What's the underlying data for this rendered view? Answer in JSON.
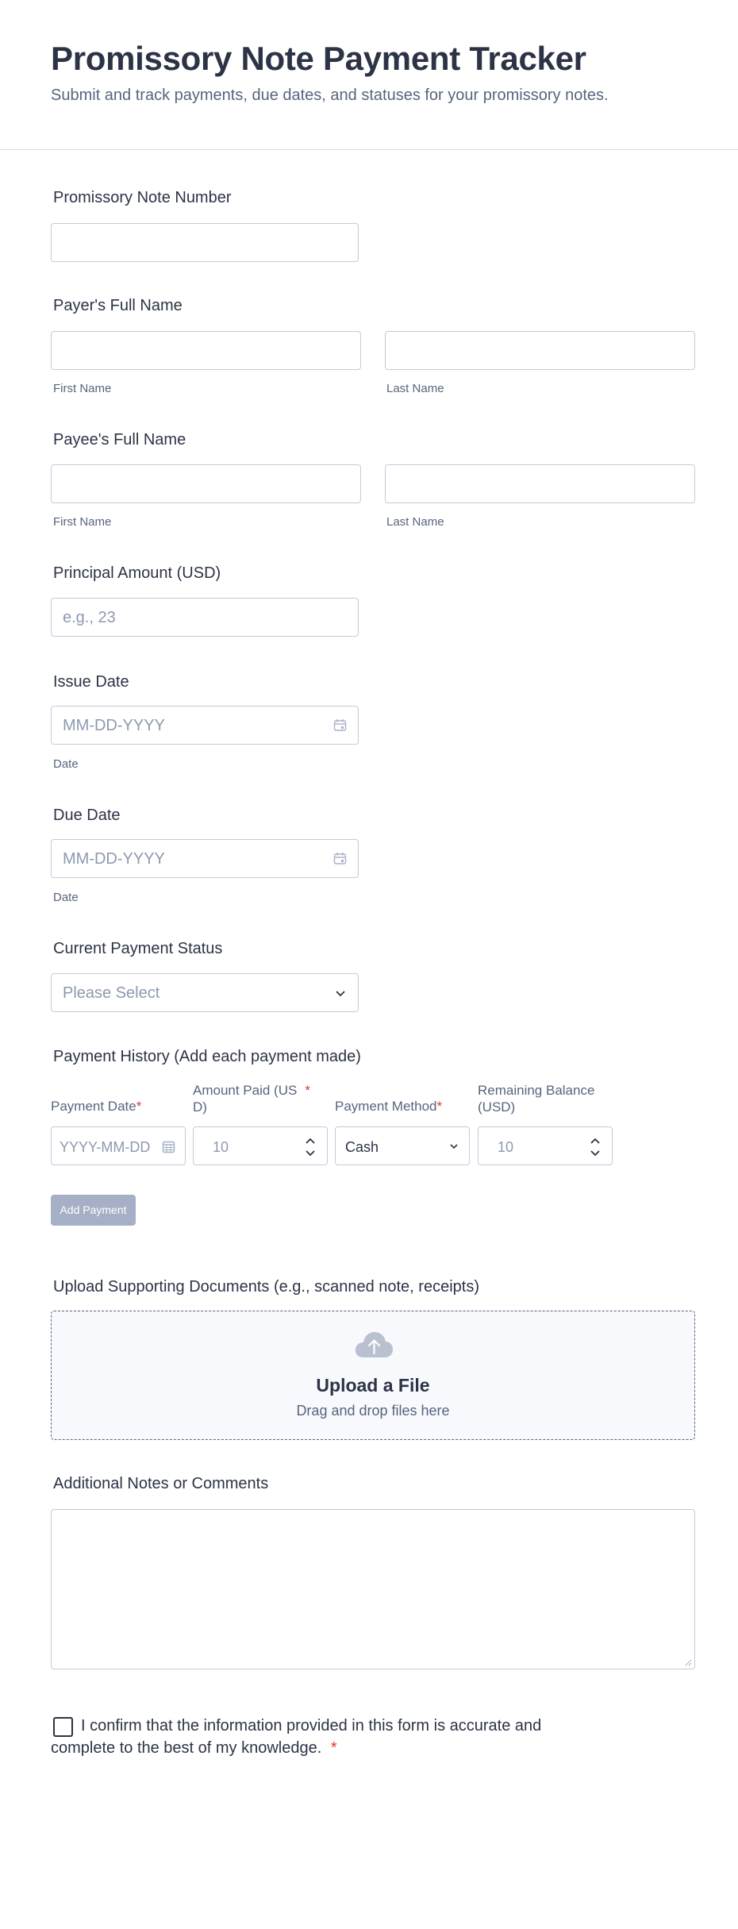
{
  "header": {
    "title": "Promissory Note Payment Tracker",
    "subtitle": "Submit and track payments, due dates, and statuses for your promissory notes."
  },
  "note_number": {
    "label": "Promissory Note Number"
  },
  "payer": {
    "label": "Payer's Full Name",
    "first_sub": "First Name",
    "last_sub": "Last Name"
  },
  "payee": {
    "label": "Payee's Full Name",
    "first_sub": "First Name",
    "last_sub": "Last Name"
  },
  "principal": {
    "label": "Principal Amount (USD)",
    "placeholder": "e.g., 23"
  },
  "issue_date": {
    "label": "Issue Date",
    "placeholder": "MM-DD-YYYY",
    "sub": "Date"
  },
  "due_date": {
    "label": "Due Date",
    "placeholder": "MM-DD-YYYY",
    "sub": "Date"
  },
  "status": {
    "label": "Current Payment Status",
    "placeholder": "Please Select"
  },
  "history": {
    "label": "Payment History (Add each payment made)",
    "columns": {
      "payment_date": "Payment Date",
      "amount_paid_line1": "Amount Paid (US",
      "amount_paid_line2": "D)",
      "payment_method": "Payment Method",
      "remaining_line1": "Remaining Balance",
      "remaining_line2": "(USD)"
    },
    "required_mark": "*",
    "row": {
      "date_placeholder": "YYYY-MM-DD",
      "amount_placeholder": "10",
      "method_value": "Cash",
      "remaining_placeholder": "10"
    },
    "add_button": "Add Payment"
  },
  "upload": {
    "label": "Upload Supporting Documents (e.g., scanned note, receipts)",
    "title": "Upload a File",
    "sub": "Drag and drop files here"
  },
  "notes": {
    "label": "Additional Notes or Comments"
  },
  "confirm": {
    "text": "I confirm that the information provided in this form is accurate and complete to the best of my knowledge.",
    "required_mark": "*"
  },
  "colors": {
    "text": "#2c3345",
    "muted": "#57647e",
    "border": "#c3cad8",
    "required": "#e3342f",
    "button_disabled": "#a5b0c6"
  }
}
